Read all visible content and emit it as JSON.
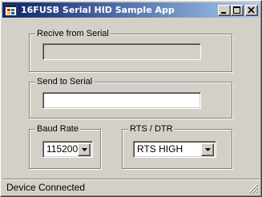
{
  "window": {
    "title": "16FUSB Serial HID Sample App",
    "icon": "app-window-icon",
    "controls": [
      "minimize-icon",
      "maximize-icon",
      "close-icon"
    ]
  },
  "receive_group": {
    "label": "Recive from Serial",
    "value": ""
  },
  "send_group": {
    "label": "Send to Serial",
    "value": ""
  },
  "baud_group": {
    "label": "Baud Rate",
    "selected": "115200"
  },
  "rts_group": {
    "label": "RTS / DTR",
    "selected": "RTS HIGH"
  },
  "status": {
    "text": "Device Connected"
  },
  "colors": {
    "titlebar_start": "#0a246a",
    "titlebar_end": "#a6caf0",
    "face": "#d4d0c8"
  }
}
